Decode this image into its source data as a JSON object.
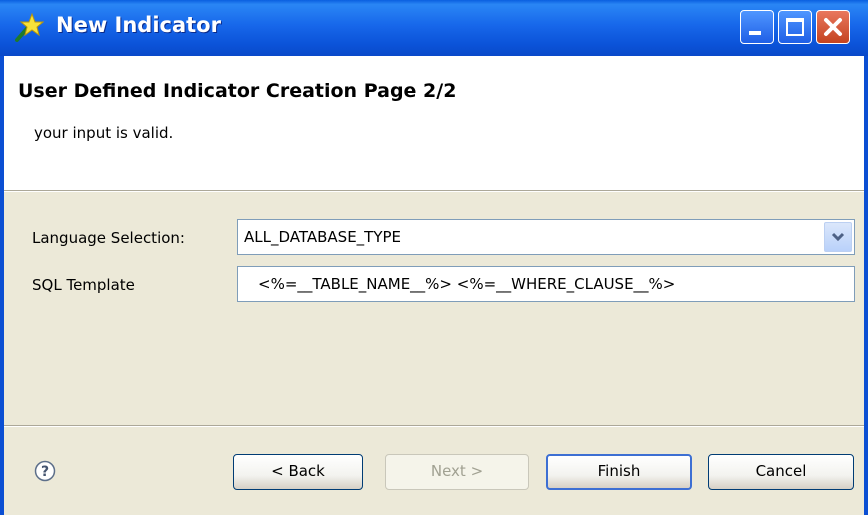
{
  "window": {
    "title": "New Indicator",
    "icon": "star-wand-icon"
  },
  "header": {
    "title": "User Defined Indicator Creation Page 2/2",
    "message": "your input is valid."
  },
  "form": {
    "language_label": "Language Selection:",
    "language_value": "ALL_DATABASE_TYPE",
    "sql_label": "SQL Template",
    "sql_value": "<%=__TABLE_NAME__%> <%=__WHERE_CLAUSE__%>"
  },
  "buttons": {
    "back": "< Back",
    "next": "Next >",
    "finish": "Finish",
    "cancel": "Cancel"
  },
  "icons": {
    "help": "help-icon",
    "dropdown": "chevron-down-icon",
    "minimize": "minimize-icon",
    "maximize": "maximize-icon",
    "close": "close-icon"
  },
  "colors": {
    "titlebar": "#0b53d8",
    "close": "#c4431f",
    "window_bg": "#ece9d8",
    "default_button_border": "#3d6fd3"
  }
}
